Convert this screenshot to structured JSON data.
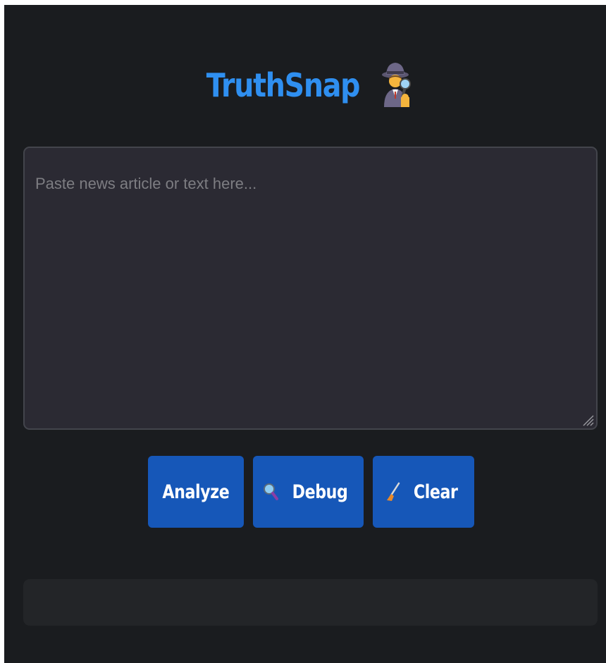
{
  "header": {
    "title": "TruthSnap",
    "title_icon": "detective-icon"
  },
  "input": {
    "placeholder": "Paste news article or text here...",
    "value": ""
  },
  "buttons": {
    "analyze_label": "Analyze",
    "debug_label": "Debug",
    "debug_icon": "magnifying-glass-icon",
    "clear_label": "Clear",
    "clear_icon": "broom-icon"
  },
  "result": {
    "text": ""
  },
  "colors": {
    "background": "#1a1c1f",
    "title": "#2f8ff0",
    "button": "#1657b8",
    "textarea_bg": "#2b2a33",
    "result_bg": "#232528"
  }
}
